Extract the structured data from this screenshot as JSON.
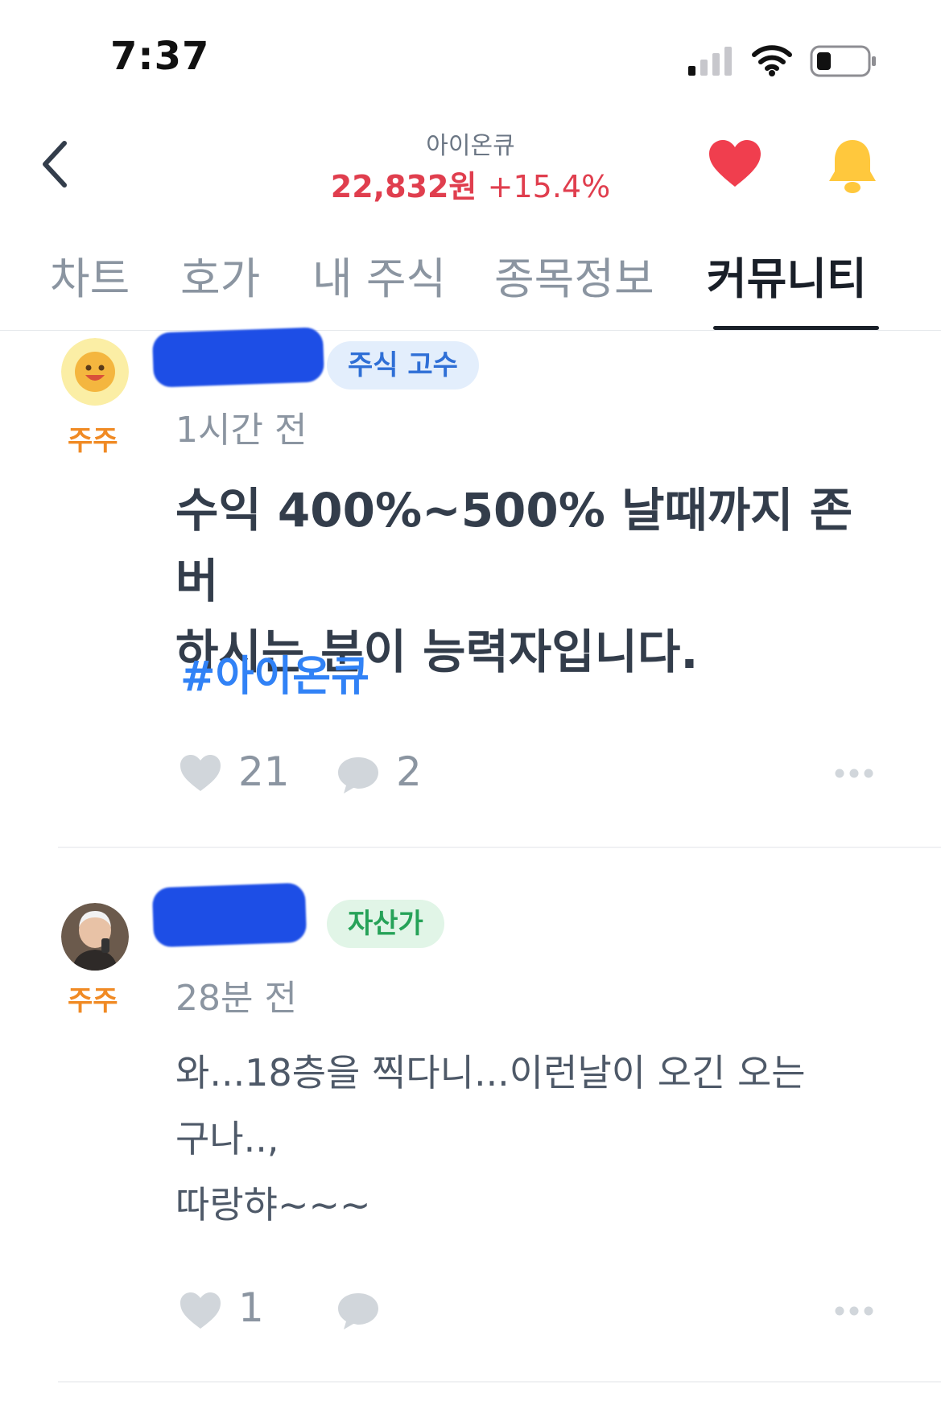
{
  "status_bar": {
    "time": "7:37"
  },
  "header": {
    "stock_name": "아이온큐",
    "price": "22,832원",
    "change": "+15.4%",
    "colors": {
      "price": "#e03e4e",
      "favorite": "#f03e4e",
      "bell": "#ffc83d"
    }
  },
  "tabs": [
    {
      "label": "차트",
      "active": false
    },
    {
      "label": "호가",
      "active": false
    },
    {
      "label": "내 주식",
      "active": false
    },
    {
      "label": "종목정보",
      "active": false
    },
    {
      "label": "커뮤니티",
      "active": true
    }
  ],
  "posts": [
    {
      "holder_label": "주주",
      "badge": "주식 고수",
      "time_ago": "1시간 전",
      "title_lines": [
        "수익 400%~500% 날때까지 존버",
        "하시는 분이 능력자입니다."
      ],
      "hashtag": "#아이온큐",
      "likes": "21",
      "comments": "2"
    },
    {
      "holder_label": "주주",
      "badge": "자산가",
      "time_ago": "28분 전",
      "body_lines": [
        "와...18층을 찍다니...이런날이 오긴 오는",
        "구나..,",
        "따랑햐~~~"
      ],
      "likes": "1",
      "comments": ""
    }
  ]
}
